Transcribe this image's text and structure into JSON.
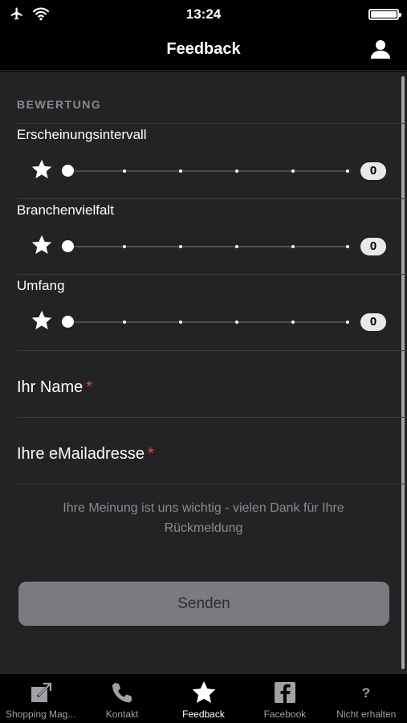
{
  "status_bar": {
    "time": "13:24"
  },
  "nav": {
    "title": "Feedback"
  },
  "section": {
    "header": "BEWERTUNG"
  },
  "ratings": [
    {
      "label": "Erscheinungsintervall",
      "value": "0"
    },
    {
      "label": "Branchenvielfalt",
      "value": "0"
    },
    {
      "label": "Umfang",
      "value": "0"
    }
  ],
  "form": {
    "name_label": "Ihr Name",
    "email_label": "Ihre eMailadresse",
    "required_mark": "*",
    "info_line1": "Ihre Meinung ist uns wichtig - vielen Dank für Ihre",
    "info_line2": "Rückmeldung",
    "send_label": "Senden"
  },
  "tabs": [
    {
      "label": "Shopping Mag...",
      "icon": "external-link-icon"
    },
    {
      "label": "Kontakt",
      "icon": "phone-icon"
    },
    {
      "label": "Feedback",
      "icon": "star-icon"
    },
    {
      "label": "Facebook",
      "icon": "facebook-icon"
    },
    {
      "label": "Nicht erhalten",
      "icon": "question-icon"
    }
  ],
  "colors": {
    "background": "#232326",
    "bar": "#000000",
    "required": "#e04646",
    "button": "#7b7b7f"
  }
}
